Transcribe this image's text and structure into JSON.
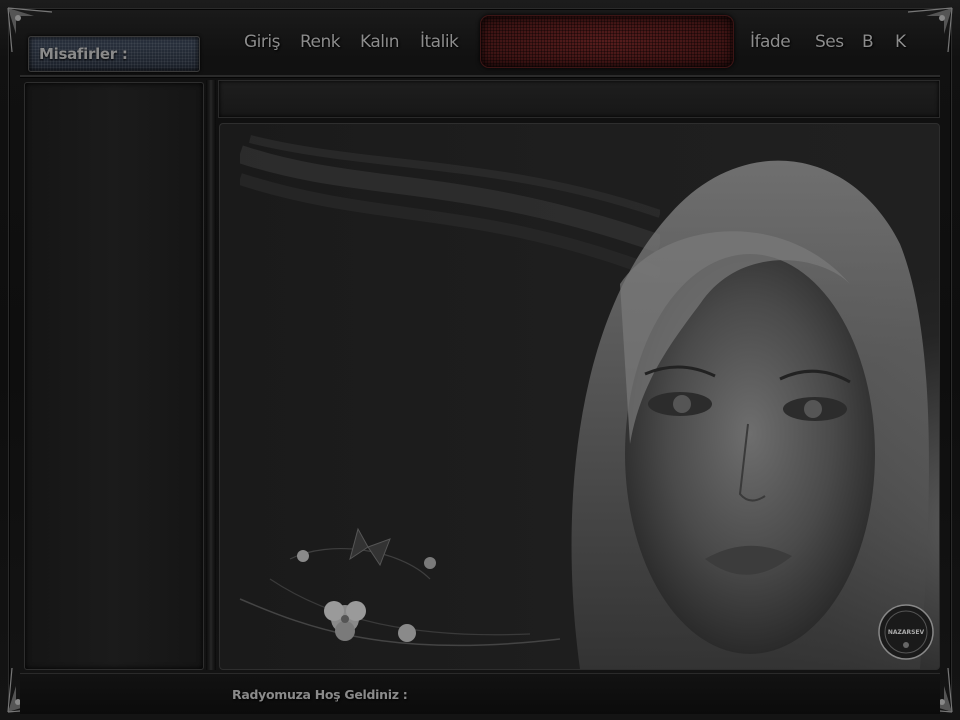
{
  "guests": {
    "label": "Misafirler :"
  },
  "toolbar": {
    "items": [
      "Giriş",
      "Renk",
      "Kalın",
      "İtalik",
      "İfade",
      "Ses",
      "B",
      "K"
    ]
  },
  "display": {
    "value": ""
  },
  "messages": {
    "value": ""
  },
  "footer": {
    "welcome": "Radyomuza Hoş Geldiniz :"
  },
  "logo": {
    "text": "NAZARSEV"
  },
  "colors": {
    "background": "#0b0b0b",
    "panel": "#1b1b1b",
    "display_red": "#4a1818",
    "text": "#8c8c8c"
  },
  "icons": [
    "corner-ornament-icon",
    "butterfly-icon",
    "flower-icon",
    "nazarsev-logo-icon"
  ]
}
